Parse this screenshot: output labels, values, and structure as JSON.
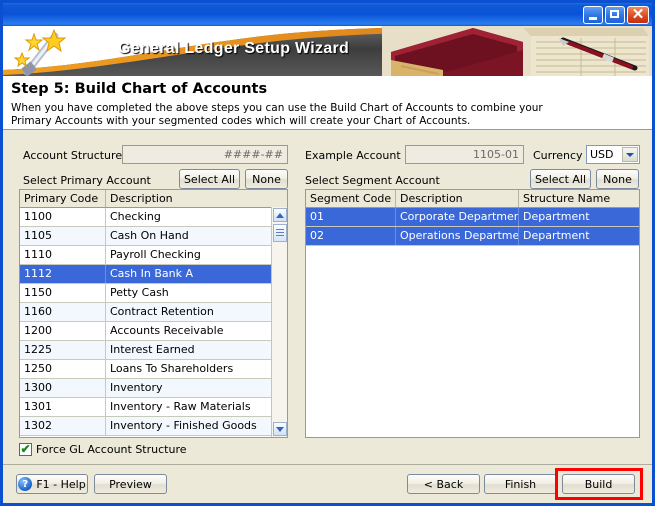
{
  "window": {
    "titlebar": {
      "minimize_label": "Minimize",
      "maximize_label": "Maximize",
      "close_label": "Close"
    }
  },
  "banner": {
    "title": "General Ledger Setup Wizard",
    "wand_icon": "magic-wand-icon",
    "books_image": "ledger-books-and-pen-photo"
  },
  "step": {
    "heading": "Step 5: Build Chart of Accounts",
    "description_line1": "When you have completed the above steps you can use the Build Chart of Accounts to combine your",
    "description_line2": "Primary Accounts with your segmented codes which will create your Chart of Accounts."
  },
  "form": {
    "account_structure_label": "Account Structure",
    "account_structure_value": "####-##",
    "example_account_label": "Example Account",
    "example_account_value": "1105-01",
    "currency_label": "Currency",
    "currency_value": "USD",
    "select_primary_label": "Select Primary Account",
    "select_segment_label": "Select Segment Account",
    "select_all_label": "Select All",
    "none_label": "None"
  },
  "primary_grid": {
    "columns": [
      "Primary Code",
      "Description"
    ],
    "rows": [
      {
        "code": "1100",
        "description": "Checking",
        "selected": false
      },
      {
        "code": "1105",
        "description": "Cash On Hand",
        "selected": false
      },
      {
        "code": "1110",
        "description": "Payroll Checking",
        "selected": false
      },
      {
        "code": "1112",
        "description": "Cash In Bank A",
        "selected": true
      },
      {
        "code": "1150",
        "description": "Petty Cash",
        "selected": false
      },
      {
        "code": "1160",
        "description": "Contract Retention",
        "selected": false
      },
      {
        "code": "1200",
        "description": "Accounts Receivable",
        "selected": false
      },
      {
        "code": "1225",
        "description": "Interest Earned",
        "selected": false
      },
      {
        "code": "1250",
        "description": "Loans To Shareholders",
        "selected": false
      },
      {
        "code": "1300",
        "description": "Inventory",
        "selected": false
      },
      {
        "code": "1301",
        "description": "Inventory - Raw Materials",
        "selected": false
      },
      {
        "code": "1302",
        "description": "Inventory - Finished Goods",
        "selected": false
      }
    ],
    "scrollbar": {
      "up_icon": "scroll-up-arrow-icon",
      "down_icon": "scroll-down-arrow-icon"
    }
  },
  "segment_grid": {
    "columns": [
      "Segment Code",
      "Description",
      "Structure Name"
    ],
    "rows": [
      {
        "code": "01",
        "description": "Corporate Department",
        "structure": "Department",
        "selected": true
      },
      {
        "code": "02",
        "description": "Operations Department",
        "structure": "Department",
        "selected": true
      }
    ]
  },
  "options": {
    "force_structure_label": "Force GL Account Structure",
    "force_structure_checked": true,
    "check_glyph": "✔"
  },
  "footer": {
    "help_label": "F1 - Help",
    "help_icon_glyph": "?",
    "preview_label": "Preview",
    "back_label": "< Back",
    "finish_label": "Finish",
    "build_label": "Build",
    "highlight_color": "#ff0000"
  }
}
